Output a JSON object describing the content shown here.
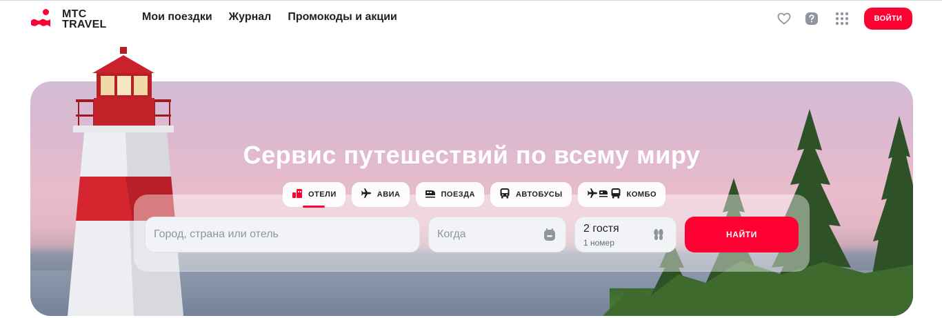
{
  "brand": {
    "line1": "МТС",
    "line2": "TRAVEL",
    "accent": "#ff0032"
  },
  "nav": [
    {
      "label": "Мои поездки"
    },
    {
      "label": "Журнал"
    },
    {
      "label": "Промокоды и акции"
    }
  ],
  "header_icons": [
    "heart-icon",
    "help-icon",
    "apps-grid-icon"
  ],
  "login_label": "ВОЙТИ",
  "hero": {
    "title": "Сервис путешествий по всему миру"
  },
  "tabs": [
    {
      "label": "ОТЕЛИ",
      "icon": "hotel-icon",
      "active": true
    },
    {
      "label": "АВИА",
      "icon": "plane-icon"
    },
    {
      "label": "ПОЕЗДА",
      "icon": "train-icon"
    },
    {
      "label": "АВТОБУСЫ",
      "icon": "bus-icon"
    },
    {
      "label": "КОМБО",
      "icon": "combo-icon"
    }
  ],
  "search": {
    "destination_placeholder": "Город, страна или отель",
    "dates_placeholder": "Когда",
    "guests": "2 гостя",
    "rooms": "1 номер",
    "submit_label": "НАЙТИ"
  }
}
